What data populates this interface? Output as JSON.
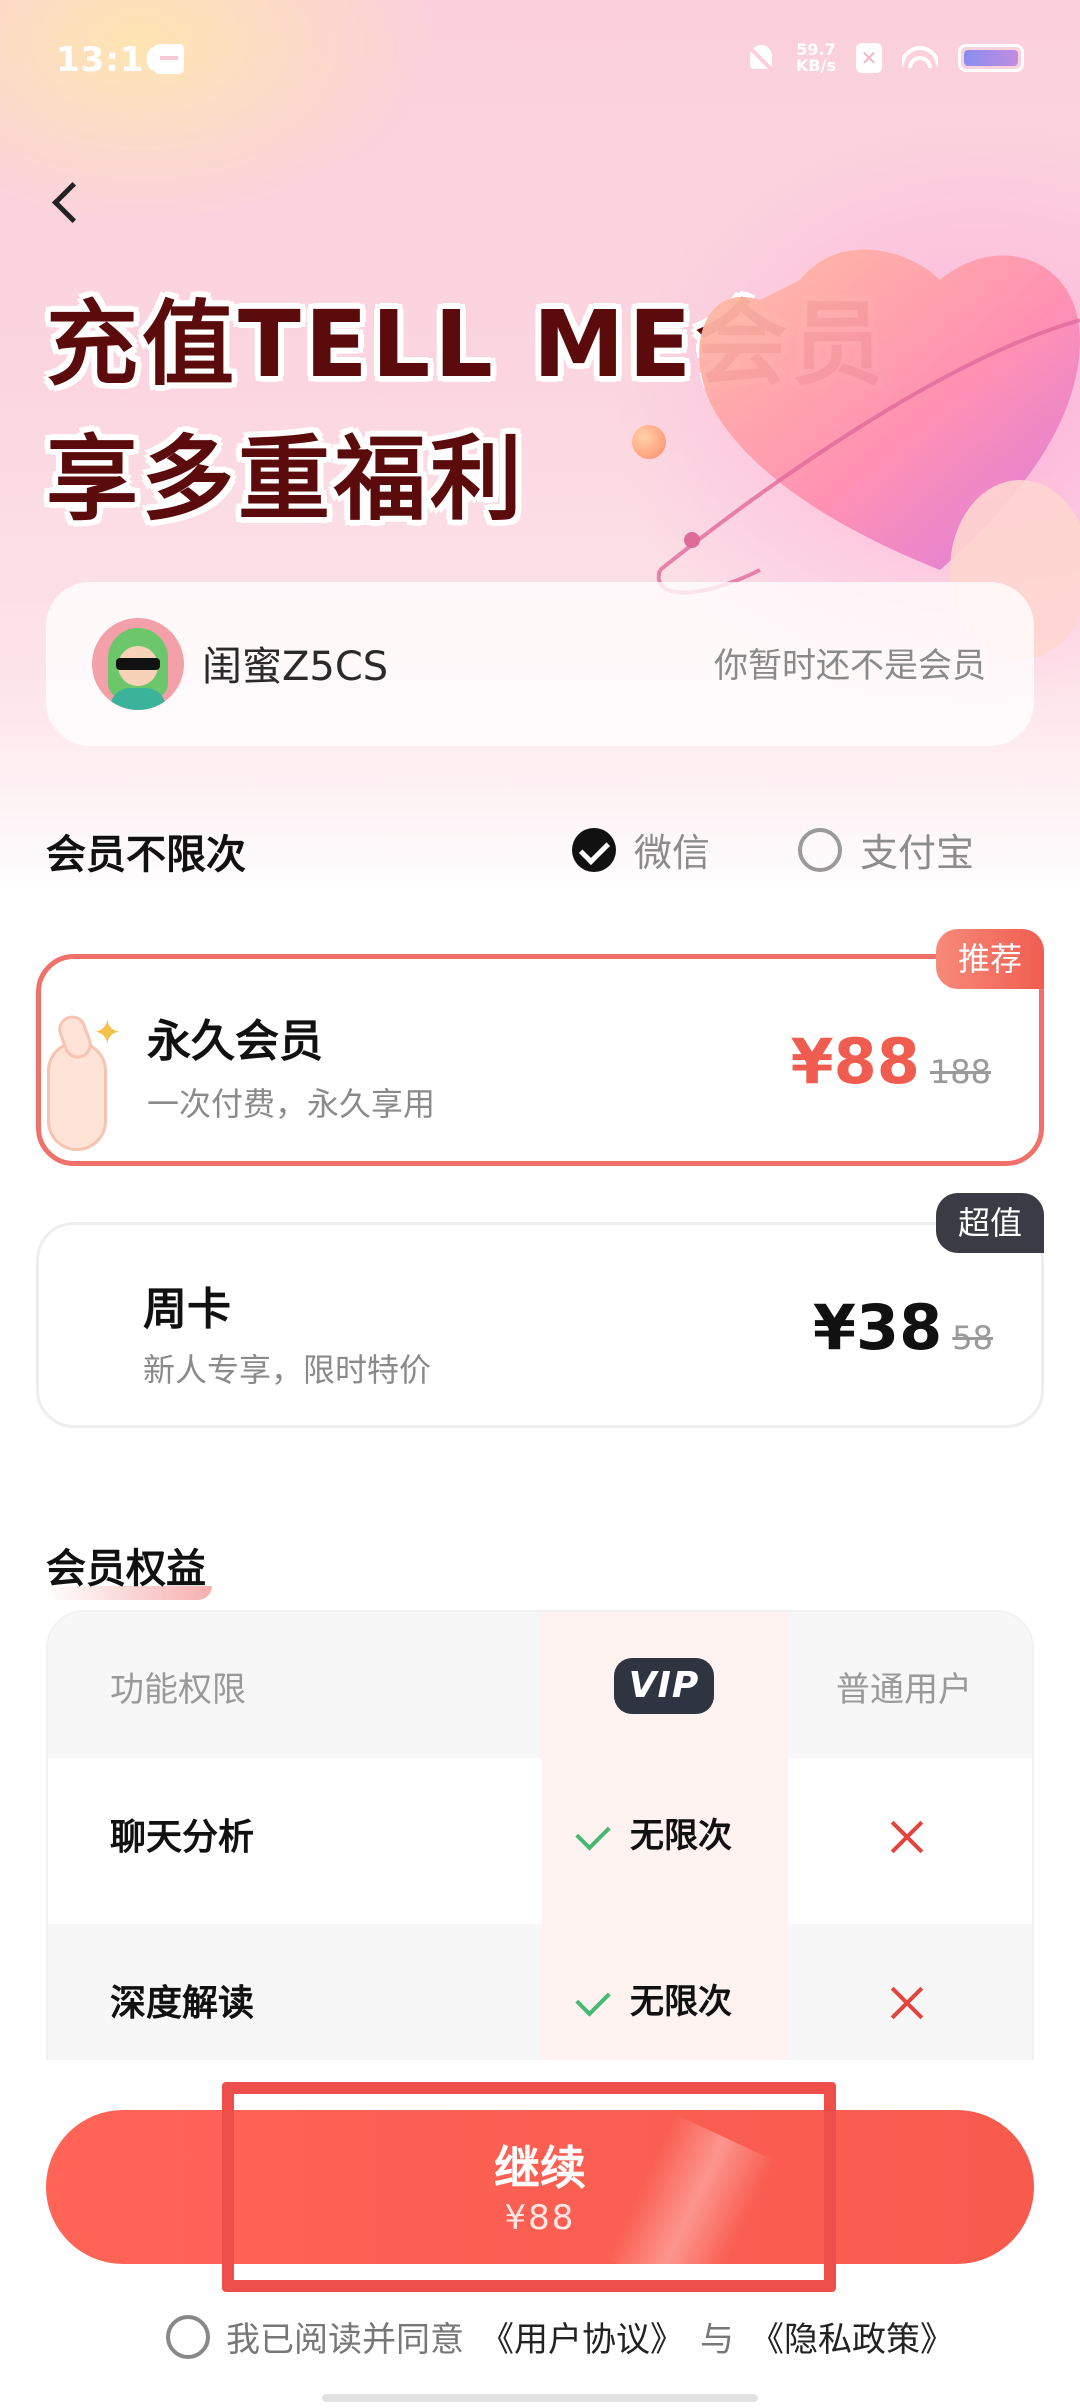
{
  "status_bar": {
    "time": "13:16",
    "net_speed_value": "59.7",
    "net_speed_unit": "KB/s",
    "icons": [
      "calendar-icon",
      "bell-off-icon",
      "x-app-icon",
      "wifi-icon",
      "battery-icon"
    ]
  },
  "hero": {
    "line1": "充值TELL ME会员",
    "line2": "享多重福利"
  },
  "user": {
    "name": "闺蜜Z5CS",
    "status": "你暂时还不是会员"
  },
  "plans_section": {
    "title": "会员不限次",
    "payment": {
      "wechat_label": "微信",
      "alipay_label": "支付宝",
      "selected": "wechat"
    },
    "plans": [
      {
        "tag": "推荐",
        "name": "永久会员",
        "desc": "一次付费，永久享用",
        "price": "¥88",
        "original_price": "188",
        "selected": true
      },
      {
        "tag": "超值",
        "name": "周卡",
        "desc": "新人专享，限时特价",
        "price": "¥38",
        "original_price": "58",
        "selected": false
      }
    ]
  },
  "benefits_section": {
    "title": "会员权益",
    "headers": {
      "feature": "功能权限",
      "vip": "VIP",
      "normal": "普通用户"
    },
    "rows": [
      {
        "feature": "聊天分析",
        "vip": "无限次",
        "normal": "×"
      },
      {
        "feature": "深度解读",
        "vip": "无限次",
        "normal": "×"
      }
    ]
  },
  "cta": {
    "label": "继续",
    "price": "¥88"
  },
  "agreement": {
    "prefix": "我已阅读并同意",
    "user_agreement": "《用户协议》",
    "conjunction": "与",
    "privacy_policy": "《隐私政策》",
    "checked": false
  },
  "colors": {
    "accent": "#f05d50",
    "title_dark": "#5b0b0b",
    "vip_badge": "#2f3540",
    "check_green": "#45b872"
  }
}
